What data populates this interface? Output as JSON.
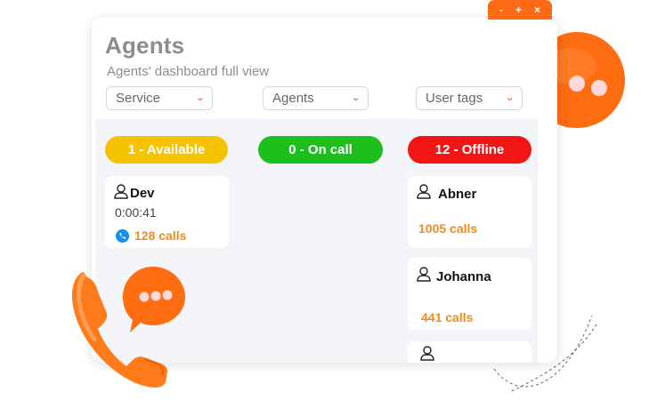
{
  "window": {
    "controls": {
      "minimize": "-",
      "maximize": "+",
      "close": "×"
    },
    "title": "Agents",
    "subtitle": "Agents' dashboard full view"
  },
  "filters": {
    "service": "Service",
    "agents": "Agents",
    "user_tags": "User tags"
  },
  "columns": {
    "available": {
      "label": "1 - Available",
      "color": "#f5c400"
    },
    "on_call": {
      "label": "0 - On call",
      "color": "#1dbf1d"
    },
    "offline": {
      "label": "12 - Offline",
      "color": "#f21515"
    }
  },
  "agents": {
    "available": [
      {
        "name": "Dev",
        "duration": "0:00:41",
        "calls": "128 calls",
        "icon": "phone-icon"
      }
    ],
    "offline": [
      {
        "name": "Abner",
        "calls": "1005 calls"
      },
      {
        "name": "Johanna",
        "calls": "441 calls"
      }
    ]
  },
  "colors": {
    "accent": "#ff6a14",
    "calls": "#f08a1c",
    "muted_text": "#8d8d8d"
  },
  "icons": [
    "chat-bubble-icon",
    "phone-handset-icon",
    "user-icon",
    "chevron-down-icon"
  ]
}
